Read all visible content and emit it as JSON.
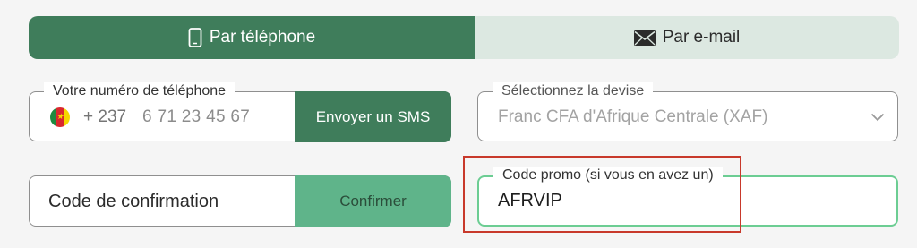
{
  "tabs": {
    "phone_label": "Par téléphone",
    "email_label": "Par e-mail",
    "phone_icon": "smartphone-icon",
    "email_icon": "envelope-icon",
    "active": "phone"
  },
  "phone": {
    "legend": "Votre numéro de téléphone",
    "country_flag": "cameroon-flag-icon",
    "dial_code": "+ 237",
    "placeholder": "6 71 23 45 67",
    "send_button": "Envoyer un SMS"
  },
  "currency": {
    "legend": "Sélectionnez la devise",
    "value": "Franc CFA d'Afrique Centrale (XAF)",
    "icon": "chevron-down-icon"
  },
  "confirmation": {
    "label": "Code de confirmation",
    "button": "Confirmer"
  },
  "promo": {
    "legend": "Code promo (si vous en avez un)",
    "value": "AFRVIP"
  },
  "colors": {
    "primary": "#3f7d5b",
    "tab_inactive_bg": "#dce8e1",
    "confirm_button": "#5fb48a",
    "promo_border": "#6ccd93",
    "highlight": "#c8392b"
  }
}
